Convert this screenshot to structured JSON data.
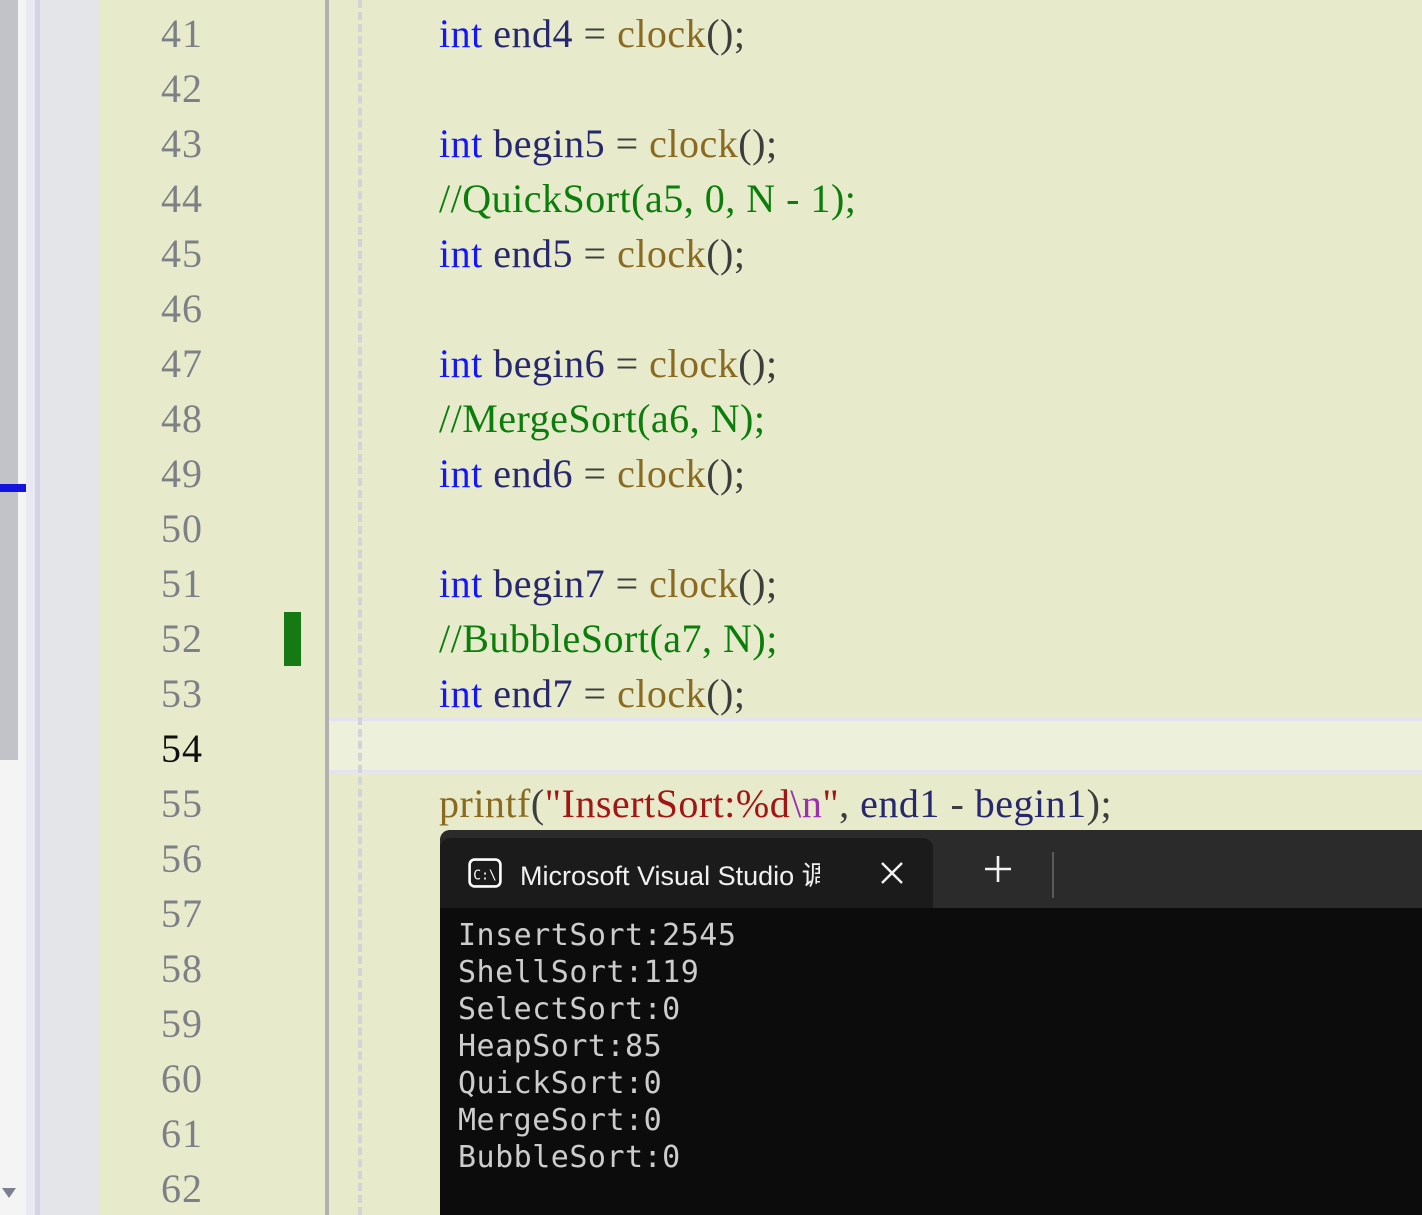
{
  "editor": {
    "background_color": "#e7ebcb",
    "active_line_number": 54,
    "change_marker_line": 52,
    "lines": [
      {
        "number": "41",
        "indent": 0,
        "tokens": [
          {
            "t": "int",
            "c": "kw"
          },
          {
            "t": " ",
            "c": "punc"
          },
          {
            "t": "end4",
            "c": "id"
          },
          {
            "t": " = ",
            "c": "punc"
          },
          {
            "t": "clock",
            "c": "fn"
          },
          {
            "t": "();",
            "c": "punc"
          }
        ]
      },
      {
        "number": "42",
        "indent": 0,
        "tokens": []
      },
      {
        "number": "43",
        "indent": 0,
        "tokens": [
          {
            "t": "int",
            "c": "kw"
          },
          {
            "t": " ",
            "c": "punc"
          },
          {
            "t": "begin5",
            "c": "id"
          },
          {
            "t": " = ",
            "c": "punc"
          },
          {
            "t": "clock",
            "c": "fn"
          },
          {
            "t": "();",
            "c": "punc"
          }
        ]
      },
      {
        "number": "44",
        "indent": 0,
        "tokens": [
          {
            "t": "//QuickSort(a5, 0, N - 1);",
            "c": "cmt"
          }
        ]
      },
      {
        "number": "45",
        "indent": 0,
        "tokens": [
          {
            "t": "int",
            "c": "kw"
          },
          {
            "t": " ",
            "c": "punc"
          },
          {
            "t": "end5",
            "c": "id"
          },
          {
            "t": " = ",
            "c": "punc"
          },
          {
            "t": "clock",
            "c": "fn"
          },
          {
            "t": "();",
            "c": "punc"
          }
        ]
      },
      {
        "number": "46",
        "indent": 0,
        "tokens": []
      },
      {
        "number": "47",
        "indent": 0,
        "tokens": [
          {
            "t": "int",
            "c": "kw"
          },
          {
            "t": " ",
            "c": "punc"
          },
          {
            "t": "begin6",
            "c": "id"
          },
          {
            "t": " = ",
            "c": "punc"
          },
          {
            "t": "clock",
            "c": "fn"
          },
          {
            "t": "();",
            "c": "punc"
          }
        ]
      },
      {
        "number": "48",
        "indent": 0,
        "tokens": [
          {
            "t": "//MergeSort(a6, N);",
            "c": "cmt"
          }
        ]
      },
      {
        "number": "49",
        "indent": 0,
        "tokens": [
          {
            "t": "int",
            "c": "kw"
          },
          {
            "t": " ",
            "c": "punc"
          },
          {
            "t": "end6",
            "c": "id"
          },
          {
            "t": " = ",
            "c": "punc"
          },
          {
            "t": "clock",
            "c": "fn"
          },
          {
            "t": "();",
            "c": "punc"
          }
        ]
      },
      {
        "number": "50",
        "indent": 0,
        "tokens": []
      },
      {
        "number": "51",
        "indent": 0,
        "tokens": [
          {
            "t": "int",
            "c": "kw"
          },
          {
            "t": " ",
            "c": "punc"
          },
          {
            "t": "begin7",
            "c": "id"
          },
          {
            "t": " = ",
            "c": "punc"
          },
          {
            "t": "clock",
            "c": "fn"
          },
          {
            "t": "();",
            "c": "punc"
          }
        ]
      },
      {
        "number": "52",
        "indent": 0,
        "tokens": [
          {
            "t": "//BubbleSort(a7, N);",
            "c": "cmt"
          }
        ]
      },
      {
        "number": "53",
        "indent": 0,
        "tokens": [
          {
            "t": "int",
            "c": "kw"
          },
          {
            "t": " ",
            "c": "punc"
          },
          {
            "t": "end7",
            "c": "id"
          },
          {
            "t": " = ",
            "c": "punc"
          },
          {
            "t": "clock",
            "c": "fn"
          },
          {
            "t": "();",
            "c": "punc"
          }
        ]
      },
      {
        "number": "54",
        "indent": 0,
        "tokens": []
      },
      {
        "number": "55",
        "indent": 0,
        "tokens": [
          {
            "t": "printf",
            "c": "fn"
          },
          {
            "t": "(",
            "c": "punc"
          },
          {
            "t": "\"InsertSort:%d",
            "c": "str"
          },
          {
            "t": "\\n",
            "c": "esc"
          },
          {
            "t": "\"",
            "c": "str"
          },
          {
            "t": ", ",
            "c": "punc"
          },
          {
            "t": "end1",
            "c": "id"
          },
          {
            "t": " - ",
            "c": "punc"
          },
          {
            "t": "begin1",
            "c": "id"
          },
          {
            "t": ");",
            "c": "punc"
          }
        ]
      },
      {
        "number": "56",
        "indent": 0,
        "tokens": []
      },
      {
        "number": "57",
        "indent": 0,
        "tokens": []
      },
      {
        "number": "58",
        "indent": 0,
        "tokens": []
      },
      {
        "number": "59",
        "indent": 0,
        "tokens": []
      },
      {
        "number": "60",
        "indent": 0,
        "tokens": []
      },
      {
        "number": "61",
        "indent": 0,
        "tokens": []
      },
      {
        "number": "62",
        "indent": 0,
        "tokens": []
      }
    ]
  },
  "terminal": {
    "tab": {
      "icon": "console-cmd-icon",
      "title": "Microsoft Visual Studio 调试挃",
      "close_label": "×"
    },
    "controls": {
      "new_tab_label": "+",
      "dropdown_label": "⌄"
    },
    "output": [
      "InsertSort:2545",
      "ShellSort:119",
      "SelectSort:0",
      "HeapSort:85",
      "QuickSort:0",
      "MergeSort:0",
      "BubbleSort:0"
    ]
  },
  "colors": {
    "editor_bg": "#e7ebcb",
    "active_line_bg": "#edf0da",
    "active_line_border": "#e3e3f1",
    "change_marker": "#157a13",
    "keyword": "#1414ff",
    "identifier": "#27276d",
    "function": "#8a6a20",
    "comment": "#0a7d0a",
    "string": "#a31515",
    "escape": "#9b2fb0",
    "terminal_bg": "#0c0c0c",
    "terminal_titlebar": "#2b2b2b",
    "terminal_tab_active": "#1b1b1b",
    "cursor_marker": "#1414e0"
  }
}
